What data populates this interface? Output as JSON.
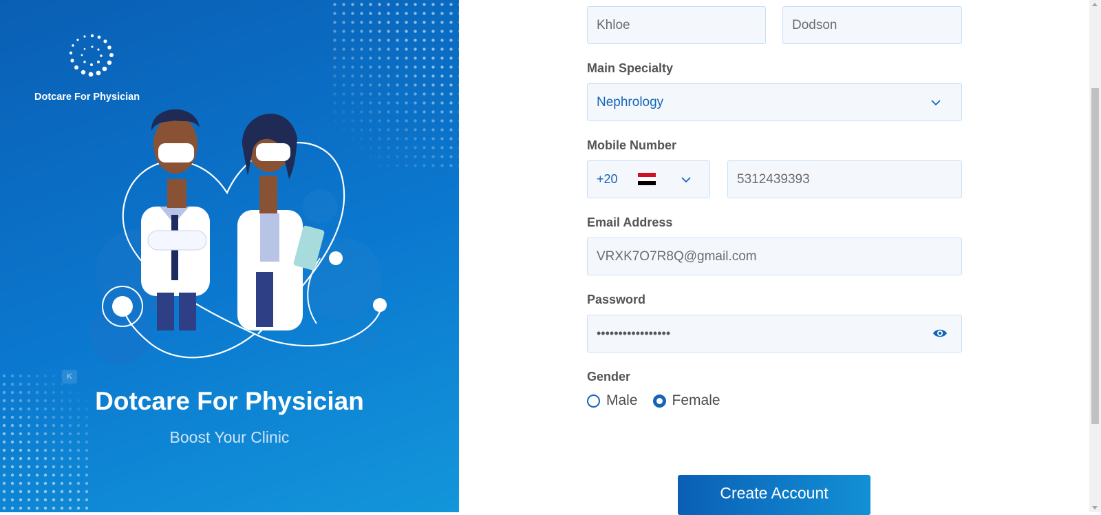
{
  "brand": {
    "logo_text": "Dotcare For Physician",
    "hero_title": "Dotcare For Physician",
    "hero_subtitle": "Boost Your Clinic",
    "badge": "K"
  },
  "form": {
    "first_name_value": "Khloe",
    "last_name_value": "Dodson",
    "specialty_label": "Main Specialty",
    "specialty_value": "Nephrology",
    "mobile_label": "Mobile Number",
    "country_code": "+20",
    "country_flag": "egypt-flag",
    "mobile_value": "5312439393",
    "email_label": "Email Address",
    "email_value": "VRXK7O7R8Q@gmail.com",
    "password_label": "Password",
    "password_value": "•••••••••••••••••",
    "gender_label": "Gender",
    "gender_options": [
      "Male",
      "Female"
    ],
    "gender_selected": "Female",
    "submit_label": "Create Account"
  },
  "icons": {
    "chevron": "chevron-down-icon",
    "eye": "eye-icon",
    "logo": "dot-ring-logo"
  },
  "colors": {
    "brand_blue": "#0a5fb4",
    "accent_blue": "#1565b6",
    "field_bg": "#f4f8fd",
    "field_border": "#c7dff4"
  }
}
